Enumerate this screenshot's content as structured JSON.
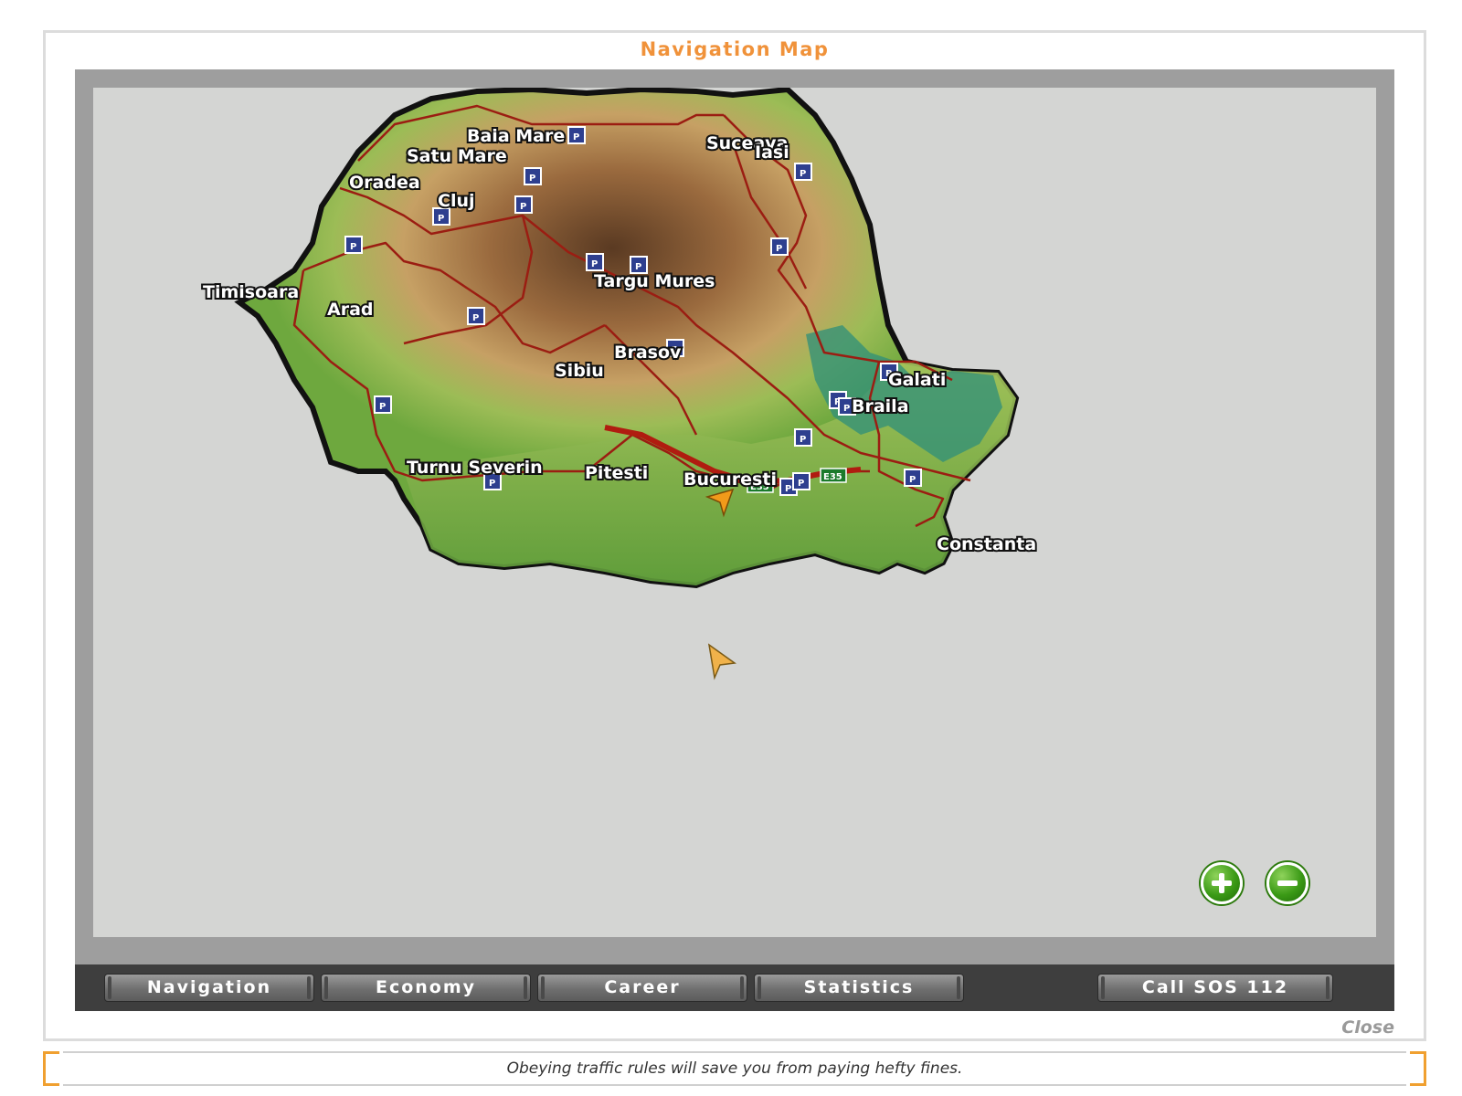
{
  "window": {
    "title": "Navigation Map"
  },
  "map": {
    "cities": [
      {
        "name": "Baia Mare"
      },
      {
        "name": "Satu Mare"
      },
      {
        "name": "Oradea"
      },
      {
        "name": "Cluj"
      },
      {
        "name": "Suceava"
      },
      {
        "name": "Iasi"
      },
      {
        "name": "Timisoara"
      },
      {
        "name": "Arad"
      },
      {
        "name": "Targu Mures"
      },
      {
        "name": "Brasov"
      },
      {
        "name": "Sibiu"
      },
      {
        "name": "Galati"
      },
      {
        "name": "Braila"
      },
      {
        "name": "Turnu Severin"
      },
      {
        "name": "Pitesti"
      },
      {
        "name": "Bucuresti"
      },
      {
        "name": "Constanta"
      }
    ],
    "road_shields": [
      "E35",
      "E35"
    ],
    "colors": {
      "land_low": "#7fb04a",
      "land_high": "#6b4a2a",
      "road": "#9b1d12",
      "water": "#2f8f7a",
      "background": "#d4d5d3"
    }
  },
  "zoom": {
    "in_icon": "plus-icon",
    "out_icon": "minus-icon"
  },
  "toolbar": {
    "navigation": "Navigation",
    "economy": "Economy",
    "career": "Career",
    "statistics": "Statistics",
    "sos": "Call SOS 112"
  },
  "close_label": "Close",
  "tip": "Obeying traffic rules will save you from paying hefty fines."
}
